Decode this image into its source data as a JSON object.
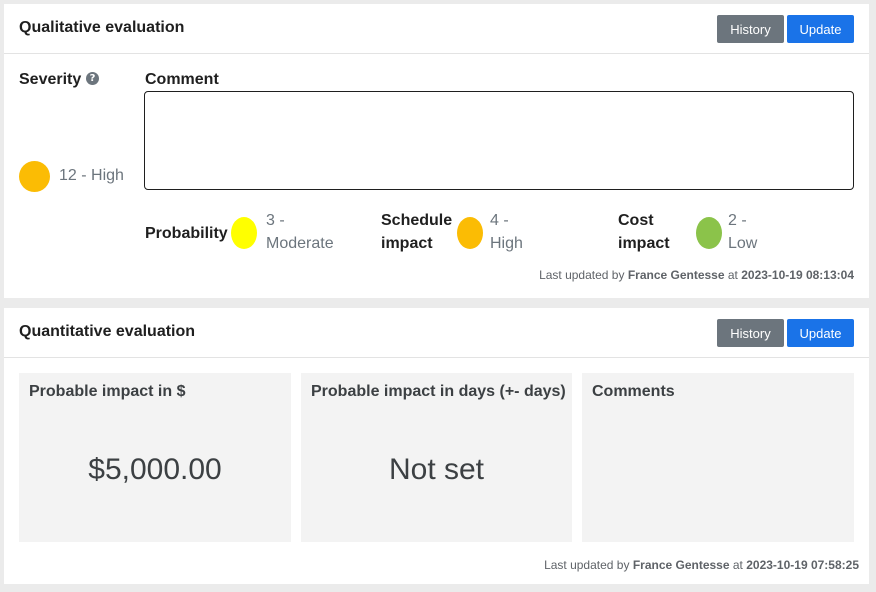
{
  "qualitative": {
    "title": "Qualitative evaluation",
    "history_label": "History",
    "update_label": "Update",
    "severity": {
      "label": "Severity",
      "help_icon": "question-circle-icon",
      "value": "12 - High",
      "color": "#fbbc04"
    },
    "comment": {
      "label": "Comment",
      "value": ""
    },
    "probability": {
      "label": "Probability",
      "value_line1": "3 -",
      "value_line2": "Moderate",
      "color": "#ffff00"
    },
    "schedule": {
      "label_line1": "Schedule",
      "label_line2": "impact",
      "value_line1": "4 -",
      "value_line2": "High",
      "color": "#fbbc04"
    },
    "cost": {
      "label_line1": "Cost",
      "label_line2": "impact",
      "value_line1": "2 -",
      "value_line2": "Low",
      "color": "#8bc34a"
    },
    "last_updated": {
      "prefix": "Last updated by",
      "user": "France Gentesse",
      "at": "at",
      "timestamp": "2023-10-19 08:13:04"
    }
  },
  "quantitative": {
    "title": "Quantitative evaluation",
    "history_label": "History",
    "update_label": "Update",
    "boxes": [
      {
        "title": "Probable impact in $",
        "value": "$5,000.00"
      },
      {
        "title": "Probable impact in days (+- days)",
        "value": "Not set"
      },
      {
        "title": "Comments",
        "value": ""
      }
    ],
    "last_updated": {
      "prefix": "Last updated by",
      "user": "France Gentesse",
      "at": "at",
      "timestamp": "2023-10-19 07:58:25"
    }
  }
}
